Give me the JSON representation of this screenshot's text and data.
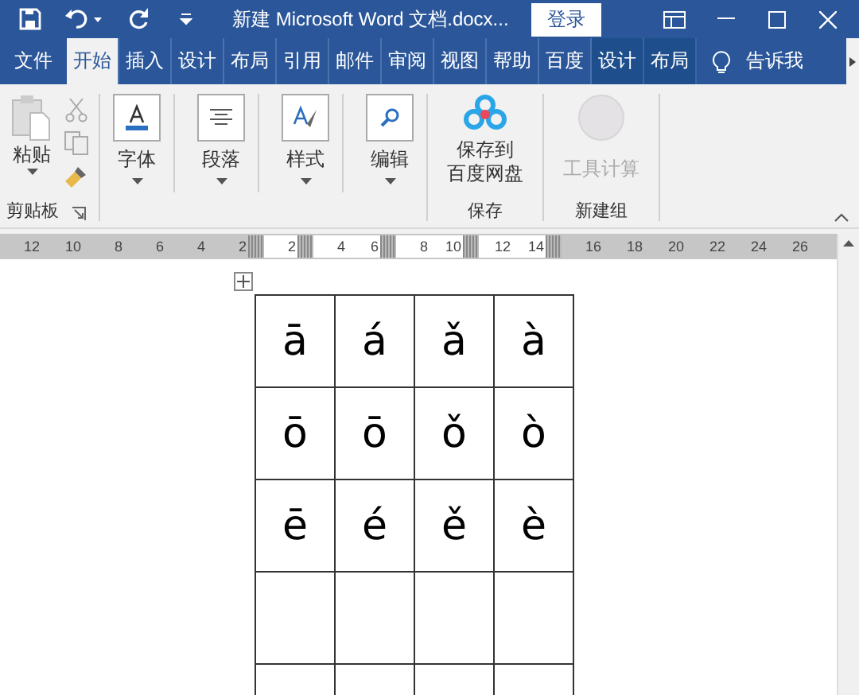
{
  "title_bar": {
    "title": "新建 Microsoft Word 文档.docx...",
    "sign_in": "登录"
  },
  "tabs": [
    {
      "label": "文件",
      "kind": "file",
      "selected": false
    },
    {
      "label": "开始",
      "kind": "normal",
      "selected": true
    },
    {
      "label": "插入",
      "kind": "normal",
      "selected": false
    },
    {
      "label": "设计",
      "kind": "normal",
      "selected": false
    },
    {
      "label": "布局",
      "kind": "normal",
      "selected": false
    },
    {
      "label": "引用",
      "kind": "normal",
      "selected": false
    },
    {
      "label": "邮件",
      "kind": "normal",
      "selected": false
    },
    {
      "label": "审阅",
      "kind": "normal",
      "selected": false
    },
    {
      "label": "视图",
      "kind": "normal",
      "selected": false
    },
    {
      "label": "帮助",
      "kind": "normal",
      "selected": false
    },
    {
      "label": "百度",
      "kind": "normal",
      "selected": false
    },
    {
      "label": "设计",
      "kind": "contextual",
      "selected": false
    },
    {
      "label": "布局",
      "kind": "contextual",
      "selected": false
    }
  ],
  "tell_me": "告诉我",
  "ribbon": {
    "groups": [
      {
        "kind": "clipboard",
        "label": "剪贴板",
        "button": "粘贴"
      },
      {
        "kind": "dropdowns",
        "buttons": [
          {
            "label": "字体"
          },
          {
            "label": "段落"
          },
          {
            "label": "样式"
          },
          {
            "label": "编辑"
          }
        ]
      },
      {
        "kind": "large",
        "label": "保存",
        "button": [
          "保存到",
          "百度网盘"
        ],
        "disabled": false
      },
      {
        "kind": "large",
        "label": "新建组",
        "button": [
          "工具计算"
        ],
        "disabled": true
      }
    ]
  },
  "ruler": [
    {
      "kind": "margin",
      "labels": [
        "12",
        "10",
        "8",
        "6",
        "4",
        "2"
      ]
    },
    {
      "kind": "marker"
    },
    {
      "kind": "text",
      "labels": [
        "2"
      ]
    },
    {
      "kind": "marker"
    },
    {
      "kind": "text",
      "labels": [
        "4",
        "6"
      ]
    },
    {
      "kind": "marker"
    },
    {
      "kind": "text",
      "labels": [
        "8",
        "10"
      ]
    },
    {
      "kind": "marker"
    },
    {
      "kind": "text",
      "labels": [
        "12",
        "14"
      ]
    },
    {
      "kind": "marker"
    },
    {
      "kind": "margin",
      "labels": [
        "16",
        "18",
        "20",
        "22",
        "24",
        "26"
      ]
    }
  ],
  "table": {
    "rows": [
      {
        "kind": "filled",
        "cells": [
          "ā",
          "á",
          "ǎ",
          "à"
        ]
      },
      {
        "kind": "filled",
        "cells": [
          "ō",
          "ō",
          "ǒ",
          "ò"
        ]
      },
      {
        "kind": "filled",
        "cells": [
          "ē",
          "é",
          "ě",
          "è"
        ]
      },
      {
        "kind": "blank"
      },
      {
        "kind": "blank"
      }
    ]
  }
}
